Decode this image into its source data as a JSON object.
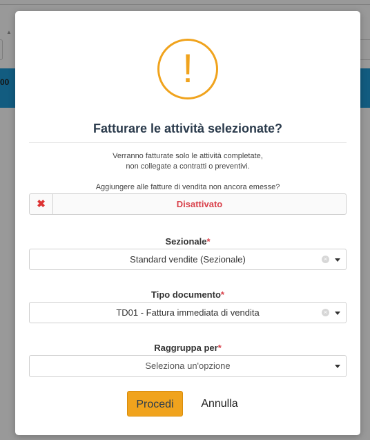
{
  "background": {
    "partial_text": "00"
  },
  "modal": {
    "title": "Fatturare le attività selezionate?",
    "note_line1": "Verranno fatturate solo le attività completate,",
    "note_line2": "non collegate a contratti o preventivi.",
    "question": "Aggiungere alle fatture di vendita non ancora emesse?",
    "toggle": {
      "icon": "close-icon",
      "label": "Disattivato",
      "state": "off"
    },
    "fields": {
      "sezionale": {
        "label": "Sezionale",
        "required": "*",
        "value": "Standard vendite (Sezionale)"
      },
      "tipo_documento": {
        "label": "Tipo documento",
        "required": "*",
        "value": "TD01 - Fattura immediata di vendita"
      },
      "raggruppa_per": {
        "label": "Raggruppa per",
        "required": "*",
        "placeholder": "Seleziona un'opzione"
      }
    },
    "buttons": {
      "confirm": "Procedi",
      "cancel": "Annulla"
    },
    "icon": "warning-icon"
  },
  "colors": {
    "warning": "#f0a31d",
    "danger": "#d9404a",
    "accent_band": "#1f9ad6"
  }
}
